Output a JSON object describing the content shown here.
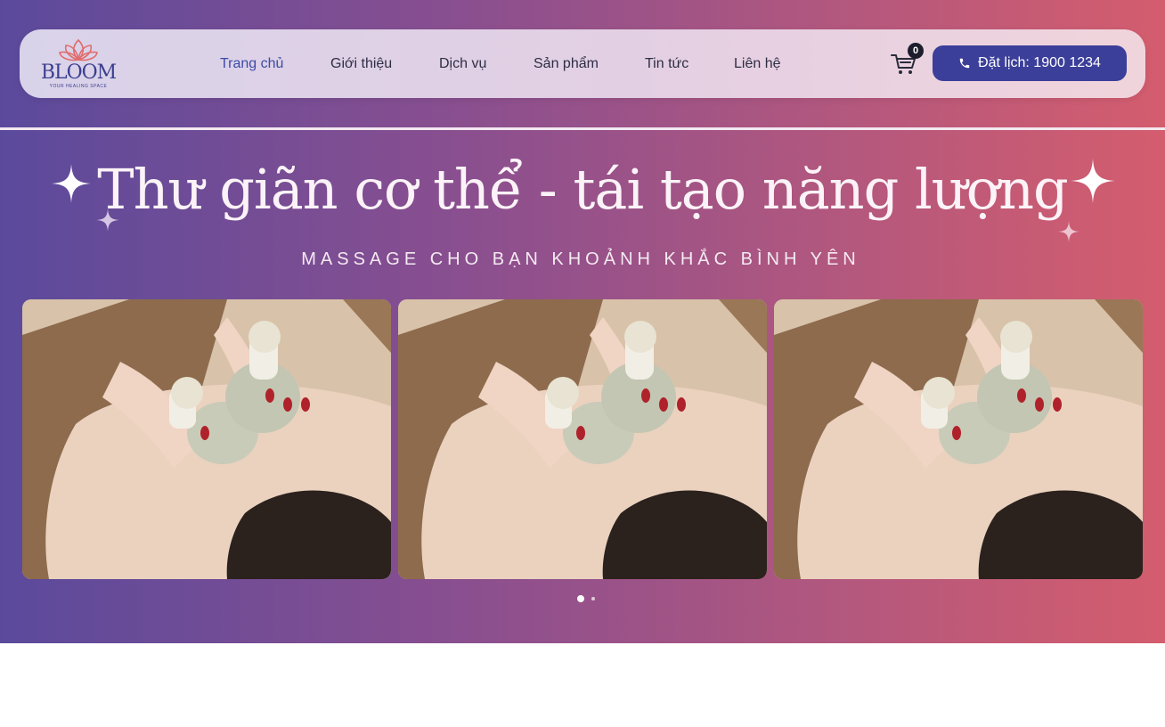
{
  "brand": {
    "name": "BLOOM",
    "tagline": "YOUR HEALING SPACE",
    "accent": "#3b3f99",
    "logo_color": "#e06c6c"
  },
  "nav": {
    "items": [
      {
        "label": "Trang chủ",
        "active": true
      },
      {
        "label": "Giới thiệu",
        "active": false
      },
      {
        "label": "Dịch vụ",
        "active": false
      },
      {
        "label": "Sản phẩm",
        "active": false
      },
      {
        "label": "Tin tức",
        "active": false
      },
      {
        "label": "Liên hệ",
        "active": false
      }
    ],
    "cart_count": "0",
    "cart_icon": "cart-icon",
    "booking_label": "Đặt lịch: 1900 1234",
    "booking_icon": "phone-icon"
  },
  "hero": {
    "title": "Thư giãn cơ thể - tái tạo năng lượng",
    "subtitle": "MASSAGE CHO BẠN KHOẢNH KHẮC BÌNH YÊN",
    "slides": [
      {
        "image": "massage-herbal-compress-photo"
      },
      {
        "image": "massage-herbal-compress-photo"
      },
      {
        "image": "massage-herbal-compress-photo"
      }
    ],
    "active_dot": 1,
    "dot_count": 2
  }
}
